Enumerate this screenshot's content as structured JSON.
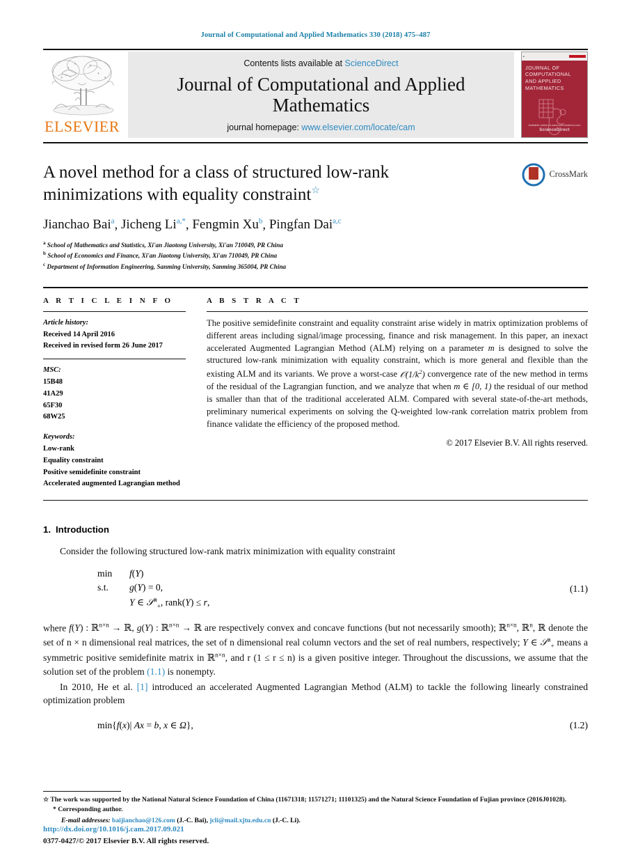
{
  "running_head": "Journal of Computational and Applied Mathematics 330 (2018) 475–487",
  "masthead": {
    "contents_prefix": "Contents lists available at ",
    "sciencedirect": "ScienceDirect",
    "journal_name": "Journal of Computational and Applied Mathematics",
    "homepage_prefix": "journal homepage: ",
    "homepage_url": "www.elsevier.com/locate/cam",
    "publisher": "ELSEVIER",
    "publisher_logo_icon": "elsevier-tree-icon",
    "cover": {
      "title": "JOURNAL OF COMPUTATIONAL AND APPLIED MATHEMATICS",
      "footer_publisher": "ScienceDirect",
      "footer_note": "Available online at www.sciencedirect.com"
    }
  },
  "article": {
    "title": "A novel method for a class of structured low-rank minimizations with equality constraint",
    "title_footnote_mark": "☆",
    "authors_html": "Jianchao Bai [a], Jicheng Li [a,*], Fengmin Xu [b], Pingfan Dai [a,c]",
    "authors": [
      {
        "name": "Jianchao Bai",
        "marks": "a"
      },
      {
        "name": "Jicheng Li",
        "marks": "a,*"
      },
      {
        "name": "Fengmin Xu",
        "marks": "b"
      },
      {
        "name": "Pingfan Dai",
        "marks": "a,c"
      }
    ],
    "affiliations": [
      {
        "mark": "a",
        "text": "School of Mathematics and Statistics, Xi'an Jiaotong University, Xi'an 710049, PR China"
      },
      {
        "mark": "b",
        "text": "School of Economics and Finance, Xi'an Jiaotong University, Xi'an 710049, PR China"
      },
      {
        "mark": "c",
        "text": "Department of Information Engineering, Sanming University, Sanming 365004, PR China"
      }
    ],
    "crossmark_label": "CrossMark",
    "crossmark_icon": "crossmark-icon"
  },
  "info": {
    "heading": "A R T I C L E   I N F O",
    "history_label": "Article history:",
    "history": [
      "Received 14 April 2016",
      "Received in revised form 26 June 2017"
    ],
    "msc_label": "MSC:",
    "msc": [
      "15B48",
      "41A29",
      "65F30",
      "68W25"
    ],
    "keywords_label": "Keywords:",
    "keywords": [
      "Low-rank",
      "Equality constraint",
      "Positive semidefinite constraint",
      "Accelerated augmented Lagrangian method"
    ]
  },
  "abstract": {
    "heading": "A B S T R A C T",
    "part1": "The positive semidefinite constraint and equality constraint arise widely in matrix optimization problems of different areas including signal/image processing, finance and risk management. In this paper, an inexact accelerated Augmented Lagrangian Method (ALM) relying on a parameter ",
    "param1": "m",
    "part2": " is designed to solve the structured low-rank minimization with equality constraint, which is more general and flexible than the existing ALM and its variants. We prove a worst-case ",
    "bigO": "O(1/k²)",
    "part3": " convergence rate of the new method in terms of the residual of the Lagrangian function, and we analyze that when ",
    "param2": "m ∈ [0, 1)",
    "part4": " the residual of our method is smaller than that of the traditional accelerated ALM. Compared with several state-of-the-art methods, preliminary numerical experiments on solving the Q-weighted low-rank correlation matrix problem from finance validate the efficiency of the proposed method.",
    "copyright": "© 2017 Elsevier B.V. All rights reserved."
  },
  "body": {
    "section_number": "1.",
    "section_title": "Introduction",
    "para1": "Consider the following structured low-rank matrix minimization with equality constraint",
    "eq1": {
      "kw_min": "min",
      "kw_st": "s.t.",
      "line1": "f(Y)",
      "line2": "g(Y) = 0,",
      "line3": "Y ∈ 𝒮ⁿ₊, rank(Y) ≤ r,",
      "number": "(1.1)"
    },
    "para2_a": "where ",
    "para2_b": "f(Y) : ℝⁿˣⁿ → ℝ, g(Y) : ℝⁿˣⁿ → ℝ are respectively convex and concave functions (but not necessarily smooth); ℝⁿˣⁿ, ℝⁿ, ℝ denote the set of n × n dimensional real matrices, the set of n dimensional real column vectors and the set of real numbers, respectively; Y ∈ 𝒮ⁿ₊ means a symmetric positive semidefinite matrix in ℝⁿˣⁿ, and r (1 ≤ r ≤ n) is a given positive integer. Throughout the discussions, we assume that the solution set of the problem ",
    "para2_ref": "(1.1)",
    "para2_c": " is nonempty.",
    "para3_a": "In 2010, He et al. ",
    "para3_ref": "[1]",
    "para3_b": " introduced an accelerated Augmented Lagrangian Method (ALM) to tackle the following linearly constrained optimization problem",
    "eq2": {
      "expr": "min{f(x)| Ax = b, x ∈ Ω},",
      "number": "(1.2)"
    }
  },
  "footnotes": {
    "funding_mark": "☆",
    "funding": "The work was supported by the National Natural Science Foundation of China (11671318; 11571271; 11101325) and the Natural Science Foundation of Fujian province (2016J01028).",
    "corresponding_mark": "*",
    "corresponding": "Corresponding author.",
    "email_label": "E-mail addresses:",
    "emails": [
      {
        "address": "baijianchao@126.com",
        "owner": "(J.-C. Bai)"
      },
      {
        "address": "jcli@mail.xjtu.edu.cn",
        "owner": "(J.-C. Li)"
      }
    ]
  },
  "footer": {
    "doi": "http://dx.doi.org/10.1016/j.cam.2017.09.021",
    "issn_line": "0377-0427/© 2017 Elsevier B.V. All rights reserved."
  },
  "colors": {
    "link_blue": "#2e8ac0",
    "running_head_blue": "#1a7fa8",
    "elsevier_orange": "#E87511",
    "cover_red": "#A32638",
    "band_gray": "#e9e9e9"
  }
}
